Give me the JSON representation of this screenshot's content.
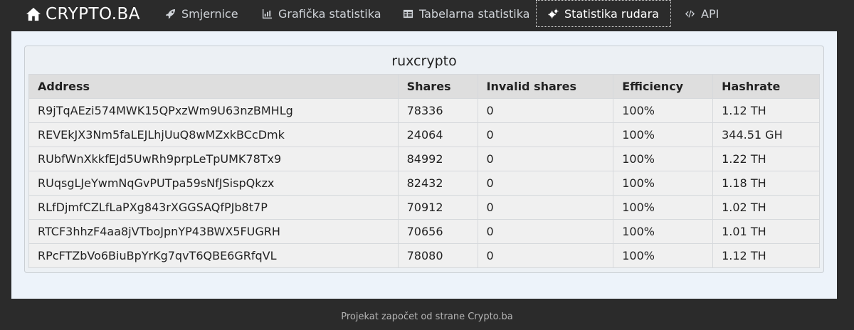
{
  "nav": {
    "brand": "CRYPTO.BA",
    "items": [
      {
        "label": "Smjernice",
        "icon": "rocket-icon"
      },
      {
        "label": "Grafička statistika",
        "icon": "bar-chart-icon"
      },
      {
        "label": "Tabelarna statistika",
        "icon": "table-icon"
      },
      {
        "label": "Statistika rudara",
        "icon": "gears-icon"
      },
      {
        "label": "API",
        "icon": "code-icon"
      }
    ]
  },
  "card": {
    "title": "ruxcrypto",
    "columns": [
      "Address",
      "Shares",
      "Invalid shares",
      "Efficiency",
      "Hashrate"
    ],
    "rows": [
      [
        "R9jTqAEzi574MWK15QPxzWm9U63nzBMHLg",
        "78336",
        "0",
        "100%",
        "1.12 TH"
      ],
      [
        "REVEkJX3Nm5faLEJLhjUuQ8wMZxkBCcDmk",
        "24064",
        "0",
        "100%",
        "344.51 GH"
      ],
      [
        "RUbfWnXkkfEJd5UwRh9prpLeTpUMK78Tx9",
        "84992",
        "0",
        "100%",
        "1.22 TH"
      ],
      [
        "RUqsgLJeYwmNqGvPUTpa59sNfJSispQkzx",
        "82432",
        "0",
        "100%",
        "1.18 TH"
      ],
      [
        "RLfDjmfCZLfLaPXg843rXGGSAQfPJb8t7P",
        "70912",
        "0",
        "100%",
        "1.02 TH"
      ],
      [
        "RTCF3hhzF4aa8jVTboJpnYP43BWX5FUGRH",
        "70656",
        "0",
        "100%",
        "1.01 TH"
      ],
      [
        "RPcFTZbVo6BiuBpYrKg7qvT6QBE6GRfqVL",
        "78080",
        "0",
        "100%",
        "1.12 TH"
      ]
    ]
  },
  "footer": {
    "text": "Projekat započet od strane Crypto.ba"
  }
}
